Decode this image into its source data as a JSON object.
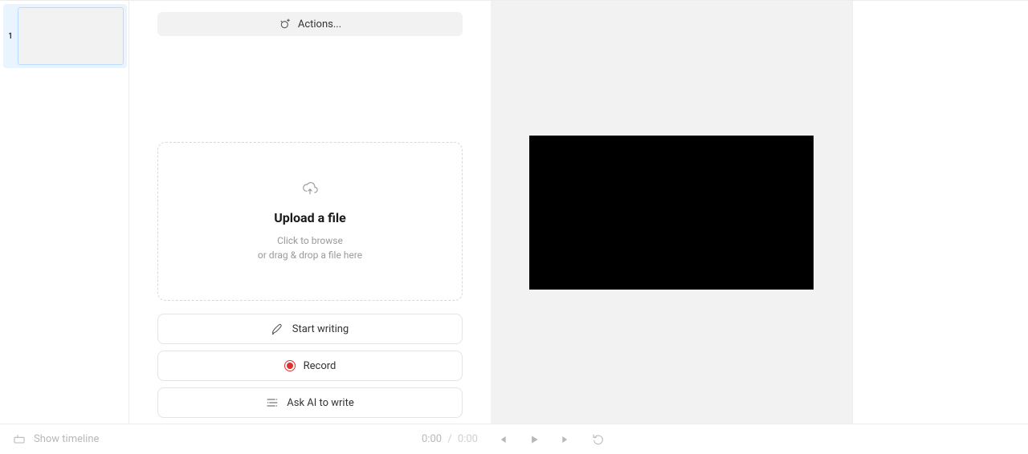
{
  "scene": {
    "number": "1"
  },
  "toolbar": {
    "actions_label": "Actions..."
  },
  "dropzone": {
    "title": "Upload a file",
    "line1": "Click to browse",
    "line2": "or drag & drop a file here"
  },
  "buttons": {
    "start_writing": "Start writing",
    "record": "Record",
    "ask_ai": "Ask AI to write"
  },
  "bottombar": {
    "show_timeline": "Show timeline",
    "current_time": "0:00",
    "duration": "0:00"
  }
}
